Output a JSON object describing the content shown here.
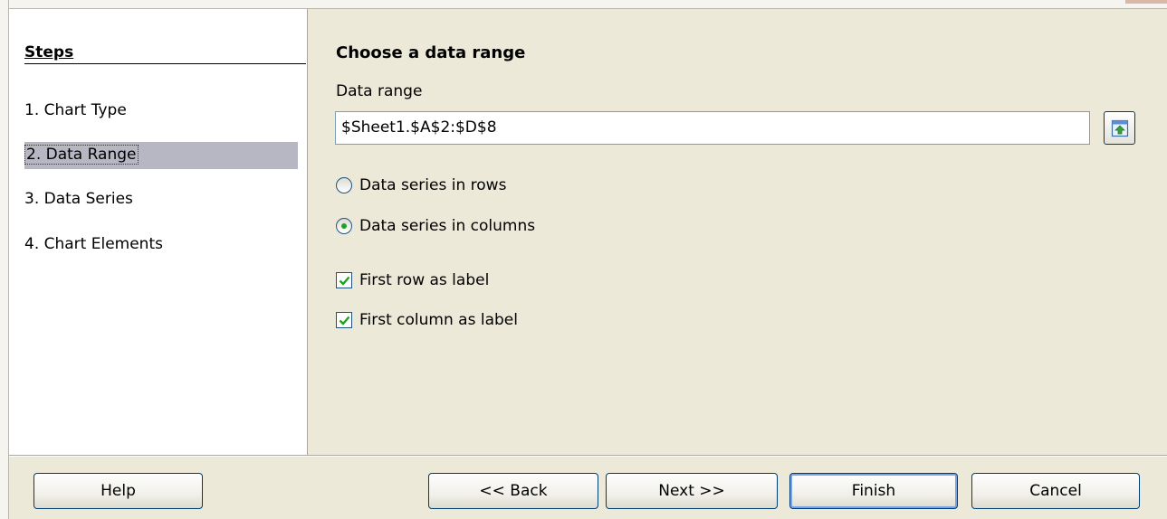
{
  "sidebar": {
    "title": "Steps",
    "items": [
      {
        "label": "1. Chart Type"
      },
      {
        "label": "2. Data Range"
      },
      {
        "label": "3. Data Series"
      },
      {
        "label": "4. Chart Elements"
      }
    ],
    "selected_index": 1
  },
  "main": {
    "heading": "Choose a data range",
    "data_range_label": "Data range",
    "data_range_value": "$Sheet1.$A$2:$D$8",
    "radio_rows_label": "Data series in rows",
    "radio_columns_label": "Data series in columns",
    "radio_selected": "columns",
    "check_first_row_label": "First row as label",
    "check_first_row_checked": true,
    "check_first_column_label": "First column as label",
    "check_first_column_checked": true
  },
  "buttons": {
    "help": "Help",
    "back": "<< Back",
    "next": "Next >>",
    "finish": "Finish",
    "cancel": "Cancel"
  },
  "icons": {
    "shrink": "shrink-range-icon",
    "checkmark": "checkmark-icon"
  },
  "colors": {
    "dialog_bg": "#ece9d8",
    "selection": "#b6b7c3",
    "button_border": "#003c74",
    "check_green": "#21a121"
  }
}
